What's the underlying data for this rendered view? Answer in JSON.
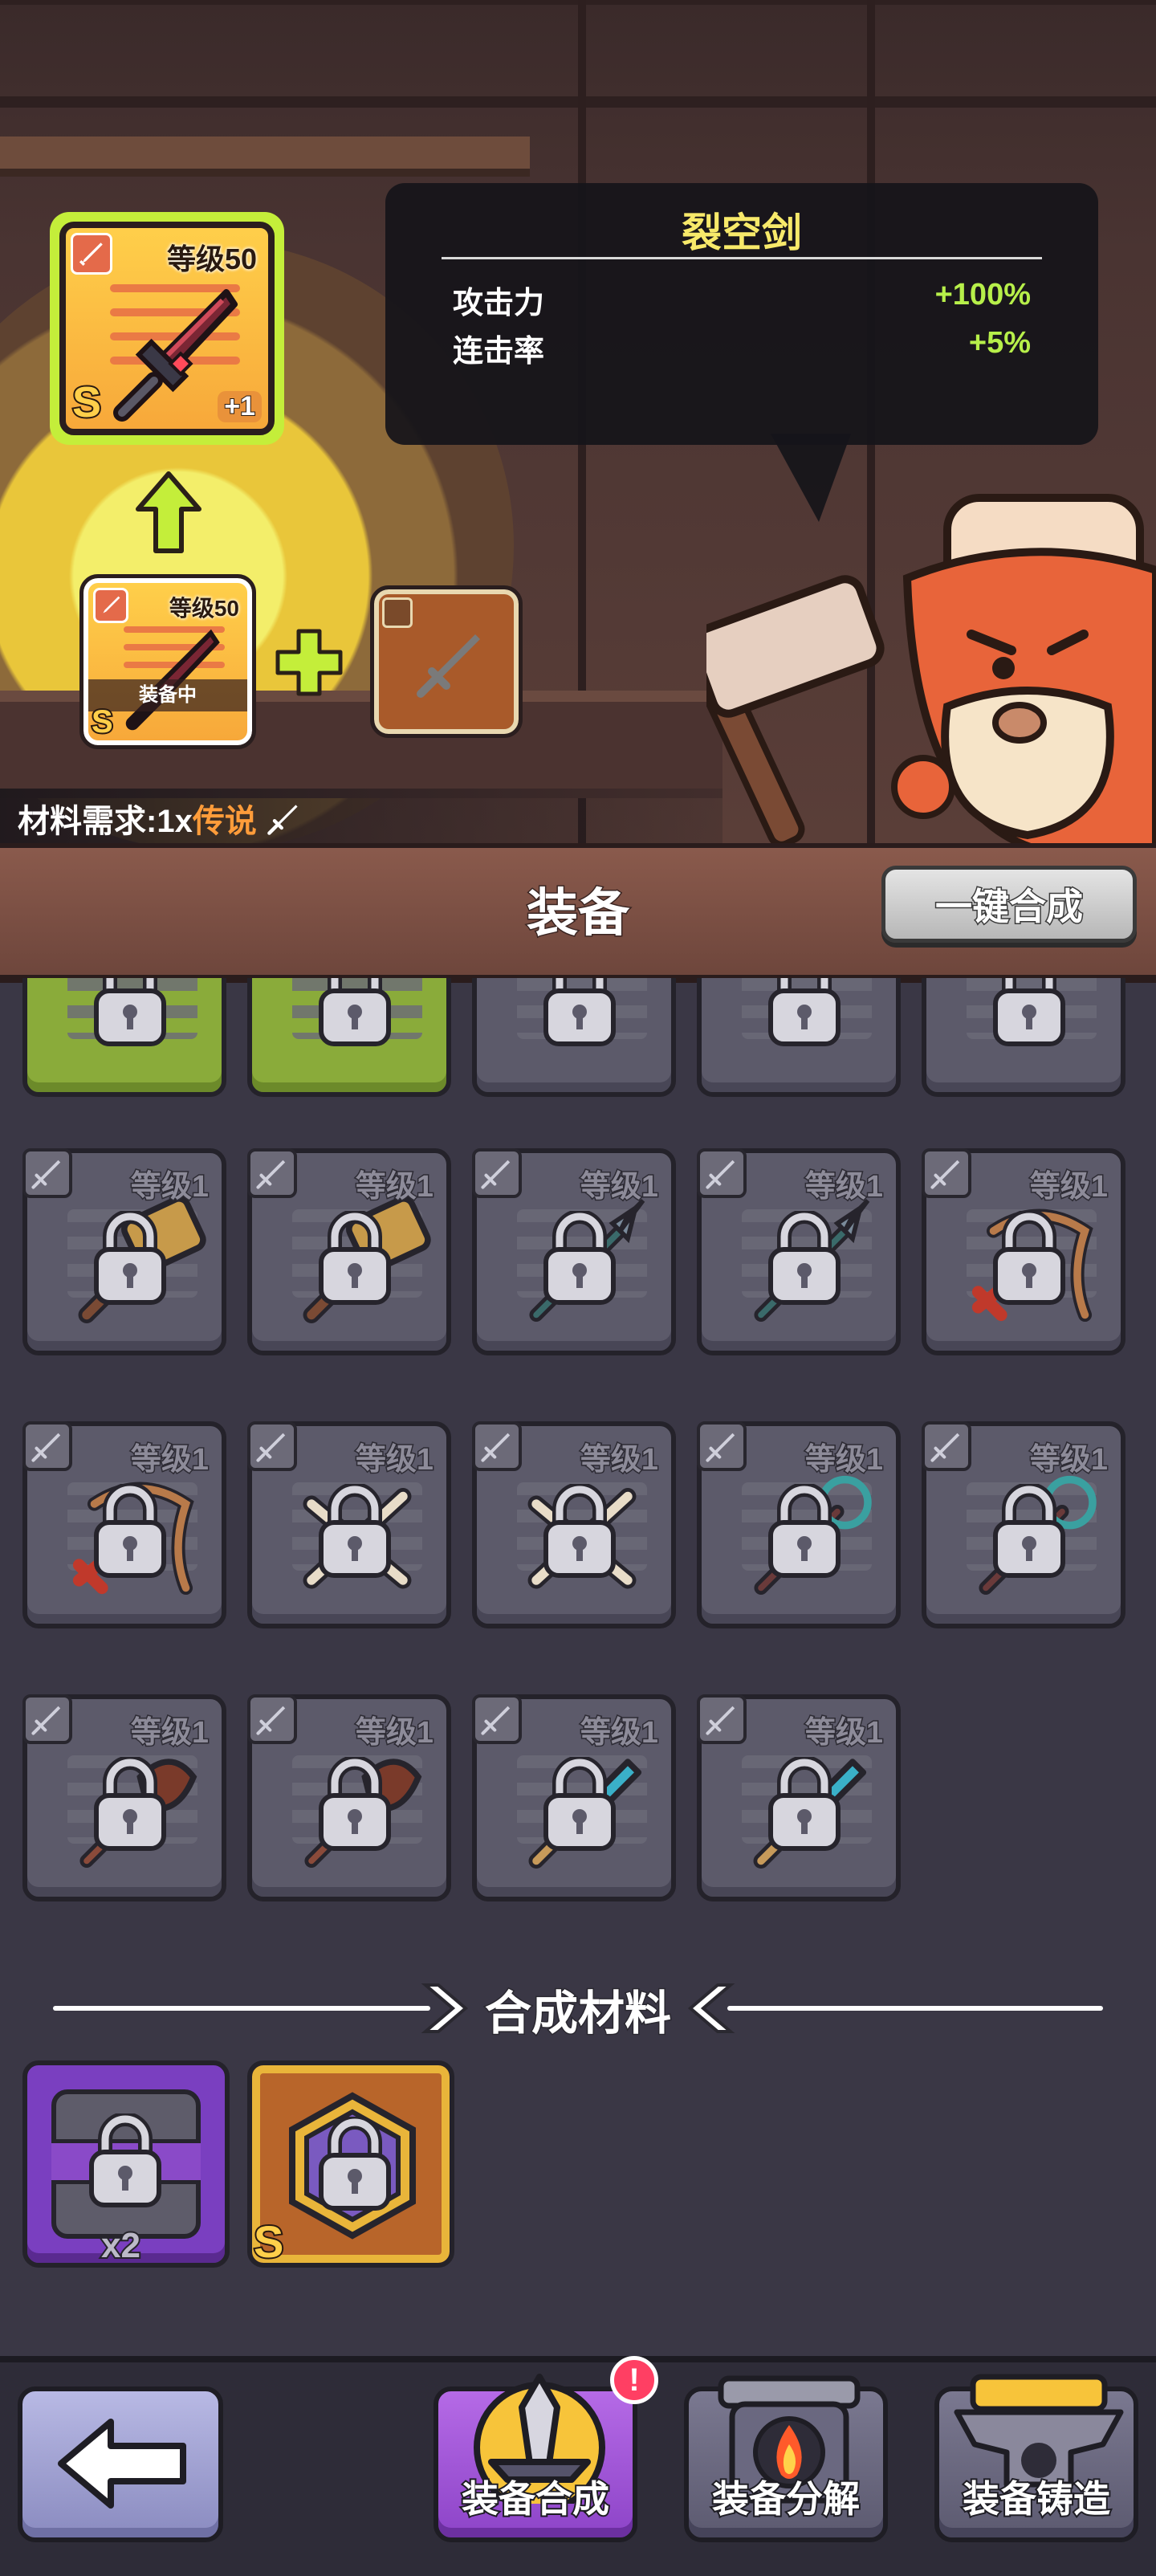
{
  "top": {
    "target_item": {
      "level": "等级50",
      "rank": "S",
      "plus": "+1"
    },
    "source_item": {
      "level": "等级50",
      "rank": "S",
      "status": "装备中"
    },
    "tooltip": {
      "name": "裂空剑",
      "stats": [
        {
          "label": "攻击力",
          "value": "+100%"
        },
        {
          "label": "连击率",
          "value": "+5%"
        }
      ]
    },
    "material_req": {
      "prefix": "材料需求:1x",
      "highlight": "传说"
    }
  },
  "header": {
    "title": "装备",
    "merge_all_label": "一键合成"
  },
  "grid": {
    "level_label": "等级1",
    "partial_row": [
      "green",
      "green",
      "gray",
      "gray",
      "gray"
    ],
    "rows": [
      [
        {
          "w": "hammer"
        },
        {
          "w": "hammer"
        },
        {
          "w": "spear"
        },
        {
          "w": "spear"
        },
        {
          "w": "bow"
        }
      ],
      [
        {
          "w": "bow"
        },
        {
          "w": "bone"
        },
        {
          "w": "bone"
        },
        {
          "w": "staff"
        },
        {
          "w": "staff"
        }
      ],
      [
        {
          "w": "club"
        },
        {
          "w": "club"
        },
        {
          "w": "sword"
        },
        {
          "w": "sword"
        }
      ]
    ]
  },
  "materials": {
    "section_title": "合成材料",
    "items": [
      {
        "type": "purple",
        "count": "x2"
      },
      {
        "type": "gold",
        "rank": "S"
      }
    ]
  },
  "nav": {
    "back": "back",
    "merge": "装备合成",
    "dismantle": "装备分解",
    "forge": "装备铸造",
    "alert": "!"
  },
  "colors": {
    "accent_green": "#b7ef4a",
    "title_yellow": "#f7e96a",
    "highlight_orange": "#ff9c3a",
    "alert": "#ff3f63"
  }
}
